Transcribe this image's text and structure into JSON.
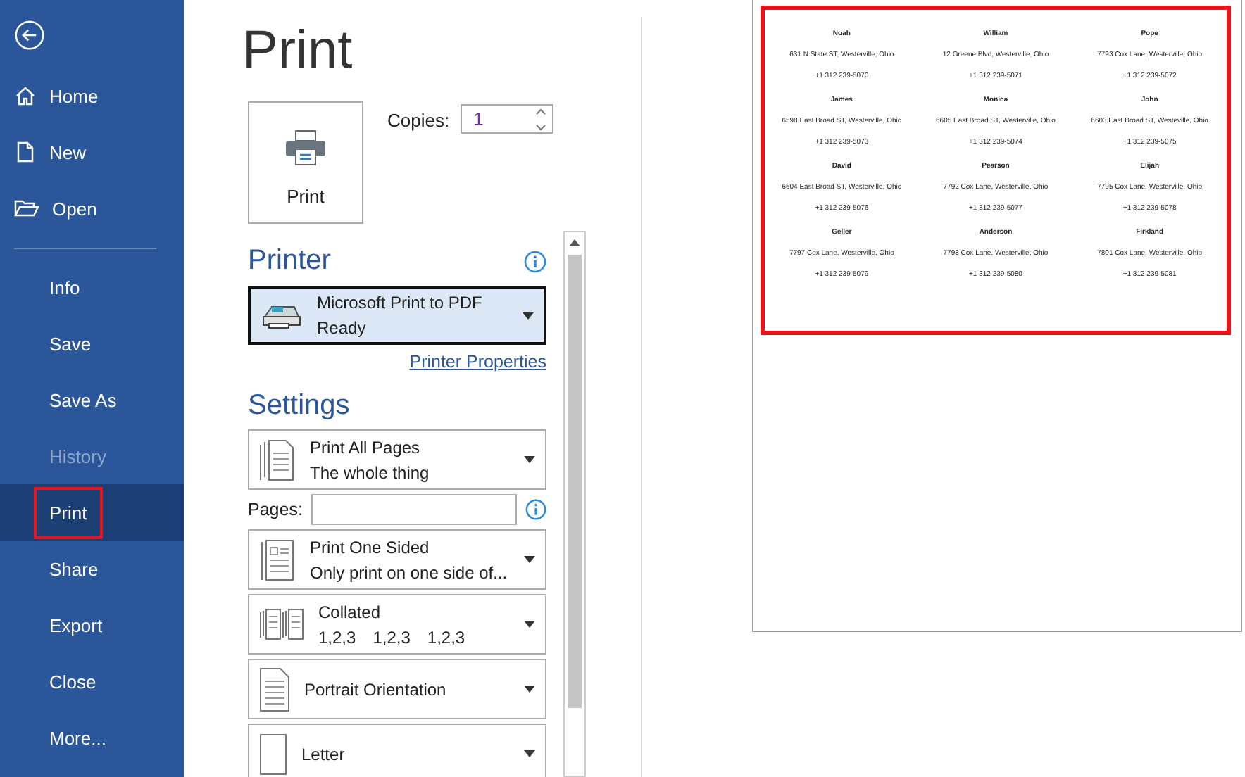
{
  "sidebar": {
    "items": [
      {
        "label": "Home",
        "kind": "home",
        "selected": false,
        "disabled": false,
        "highlighted": false
      },
      {
        "label": "New",
        "kind": "new",
        "selected": false,
        "disabled": false,
        "highlighted": false
      },
      {
        "label": "Open",
        "kind": "open",
        "selected": false,
        "disabled": false,
        "highlighted": false
      },
      {
        "label": "Info",
        "kind": "plain",
        "selected": false,
        "disabled": false,
        "highlighted": false
      },
      {
        "label": "Save",
        "kind": "plain",
        "selected": false,
        "disabled": false,
        "highlighted": false
      },
      {
        "label": "Save As",
        "kind": "plain",
        "selected": false,
        "disabled": false,
        "highlighted": false
      },
      {
        "label": "History",
        "kind": "plain",
        "selected": false,
        "disabled": true,
        "highlighted": false
      },
      {
        "label": "Print",
        "kind": "plain",
        "selected": true,
        "disabled": false,
        "highlighted": true
      },
      {
        "label": "Share",
        "kind": "plain",
        "selected": false,
        "disabled": false,
        "highlighted": false
      },
      {
        "label": "Export",
        "kind": "plain",
        "selected": false,
        "disabled": false,
        "highlighted": false
      },
      {
        "label": "Close",
        "kind": "plain",
        "selected": false,
        "disabled": false,
        "highlighted": false
      },
      {
        "label": "More...",
        "kind": "plain",
        "selected": false,
        "disabled": false,
        "highlighted": false
      }
    ]
  },
  "title": "Print",
  "print_button": {
    "label": "Print"
  },
  "copies": {
    "label": "Copies:",
    "value": "1"
  },
  "printer": {
    "heading": "Printer",
    "name": "Microsoft Print to PDF",
    "status": "Ready",
    "properties_link": "Printer Properties"
  },
  "settings": {
    "heading": "Settings",
    "items": [
      {
        "kind": "pages",
        "title": "Print All Pages",
        "subtitle": "The whole thing"
      },
      {
        "kind": "field",
        "label": "Pages:"
      },
      {
        "kind": "onesided",
        "title": "Print One Sided",
        "subtitle": "Only print on one side of..."
      },
      {
        "kind": "collated",
        "title": "Collated",
        "subtitle_parts": [
          "1,2,3",
          "1,2,3",
          "1,2,3"
        ]
      },
      {
        "kind": "portrait",
        "title": "Portrait Orientation"
      },
      {
        "kind": "letter",
        "title": "Letter"
      }
    ]
  },
  "preview": {
    "highlighted": true,
    "labels": [
      {
        "name": "Noah",
        "address": "631 N.State ST, Westerville, Ohio",
        "phone": "+1 312 239-5070"
      },
      {
        "name": "William",
        "address": "12 Greene Blvd, Westerville, Ohio",
        "phone": "+1 312 239-5071"
      },
      {
        "name": "Pope",
        "address": "7793 Cox Lane, Westerville, Ohio",
        "phone": "+1 312 239-5072"
      },
      {
        "name": "James",
        "address": "6598 East Broad ST, Westerville, Ohio",
        "phone": "+1 312 239-5073"
      },
      {
        "name": "Monica",
        "address": "6605 East Broad ST, Westerville, Ohio",
        "phone": "+1 312 239-5074"
      },
      {
        "name": "John",
        "address": "6603 East Broad ST, Westeville, Ohio",
        "phone": "+1 312 239-5075"
      },
      {
        "name": "David",
        "address": "6604 East Broad ST, Westerville, Ohio",
        "phone": "+1 312 239-5076"
      },
      {
        "name": "Pearson",
        "address": "7792 Cox Lane, Westerville, Ohio",
        "phone": "+1 312 239-5077"
      },
      {
        "name": "Elijah",
        "address": "7795 Cox Lane, Westerville, Ohio",
        "phone": "+1 312 239-5078"
      },
      {
        "name": "Geller",
        "address": "7797 Cox Lane, Westerville, Ohio",
        "phone": "+1 312 239-5079"
      },
      {
        "name": "Anderson",
        "address": "7798 Cox Lane, Westerville, Ohio",
        "phone": "+1 312 239-5080"
      },
      {
        "name": "Firkland",
        "address": "7801 Cox Lane, Westerville, Ohio",
        "phone": "+1 312 239-5081"
      }
    ]
  }
}
